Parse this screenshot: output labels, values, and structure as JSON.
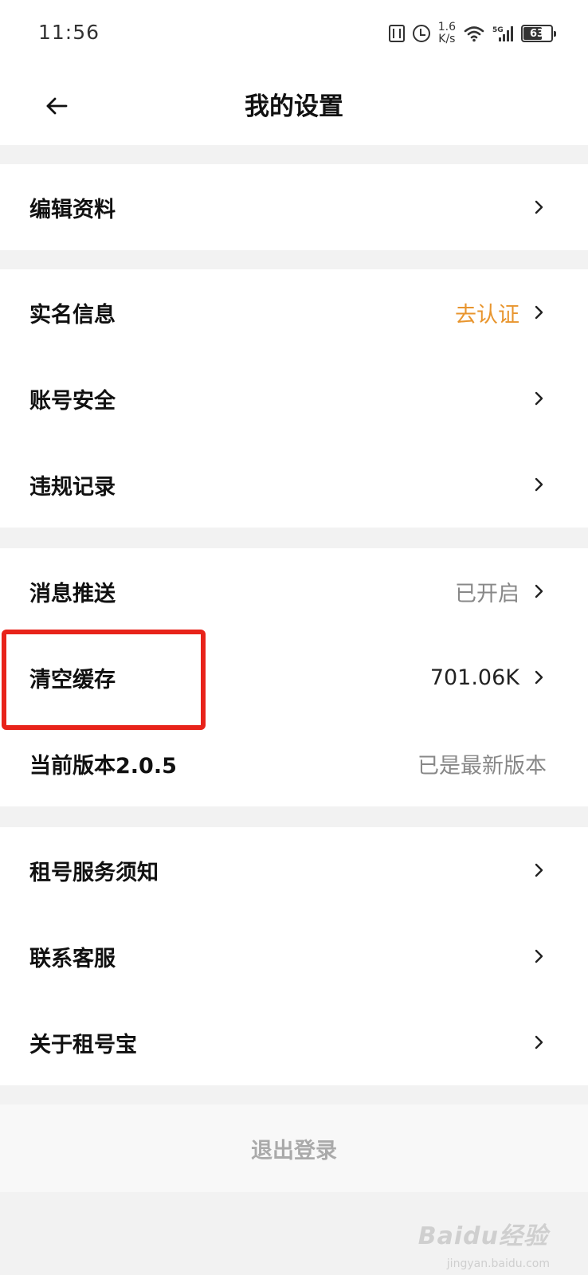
{
  "status_bar": {
    "time": "11:56",
    "net_speed_value": "1.6",
    "net_speed_unit": "K/s",
    "signal_label": "5G",
    "battery_level": "63"
  },
  "header": {
    "title": "我的设置"
  },
  "groups": [
    {
      "items": [
        {
          "label": "编辑资料"
        }
      ]
    },
    {
      "items": [
        {
          "label": "实名信息",
          "value": "去认证"
        },
        {
          "label": "账号安全"
        },
        {
          "label": "违规记录"
        }
      ]
    },
    {
      "items": [
        {
          "label": "消息推送",
          "value": "已开启"
        },
        {
          "label": "清空缓存",
          "value": "701.06K"
        },
        {
          "label": "当前版本2.0.5",
          "value": "已是最新版本"
        }
      ]
    },
    {
      "items": [
        {
          "label": "租号服务须知"
        },
        {
          "label": "联系客服"
        },
        {
          "label": "关于租号宝"
        }
      ]
    }
  ],
  "logout": {
    "label": "退出登录"
  },
  "watermark": {
    "brand": "Baidu经验",
    "url": "jingyan.baidu.com"
  },
  "colors": {
    "accent": "#e8952e",
    "highlight": "#e8231a",
    "background": "#f2f2f2"
  }
}
